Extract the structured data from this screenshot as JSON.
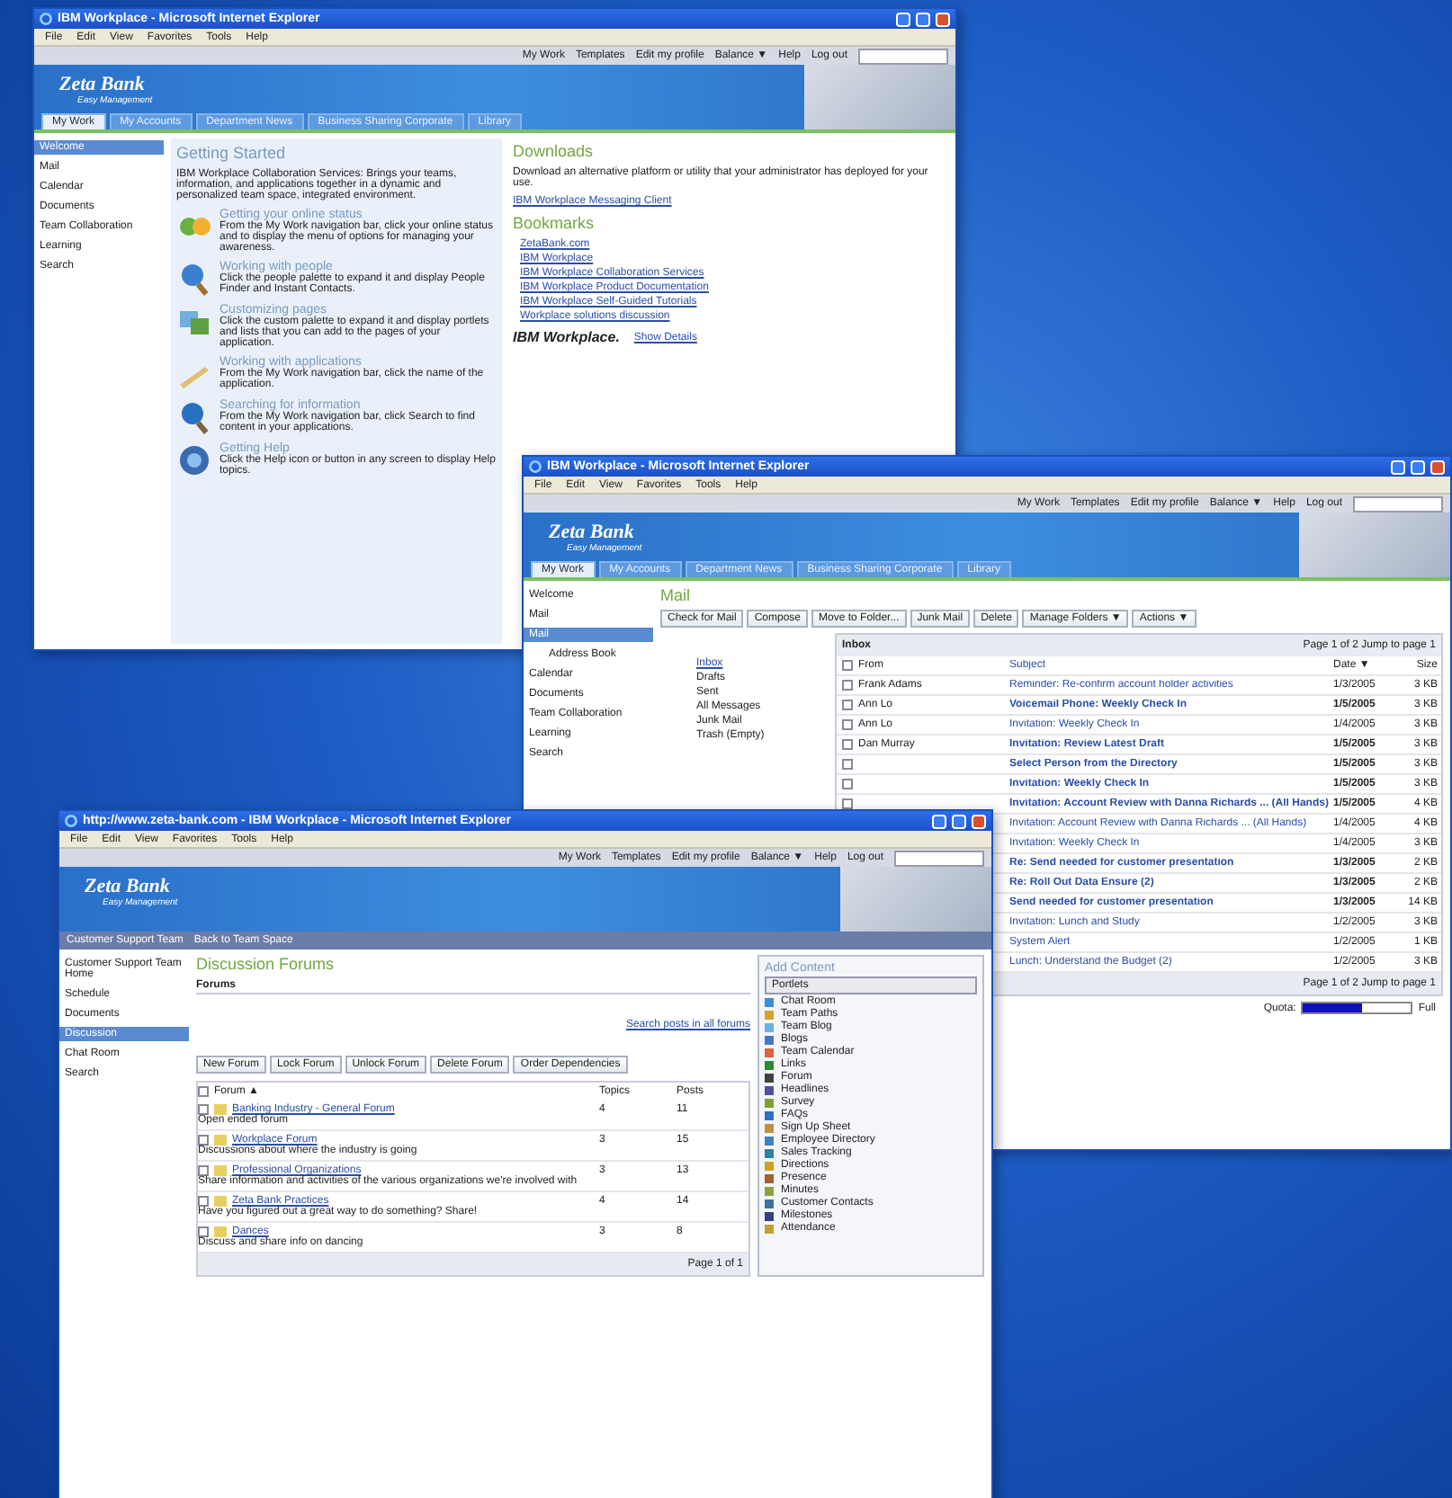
{
  "windows": [
    {
      "kind": "home",
      "title": "IBM Workplace - Microsoft Internet Explorer",
      "menu": [
        "File",
        "Edit",
        "View",
        "Favorites",
        "Tools",
        "Help"
      ],
      "top_links": [
        "My Work",
        "Templates",
        "Edit my profile",
        "Balance ▼",
        "Help",
        "Log out"
      ],
      "logo": "Zeta Bank",
      "logo_tagline": "Easy Management",
      "tabs": [
        {
          "label": "My Work",
          "selected": true
        },
        {
          "label": "My Accounts",
          "selected": false
        },
        {
          "label": "Department News",
          "selected": false
        },
        {
          "label": "Business Sharing Corporate",
          "selected": false
        },
        {
          "label": "Library",
          "selected": false
        }
      ],
      "sidebar": [
        {
          "label": "Welcome",
          "selected": true
        },
        {
          "label": "Mail",
          "selected": false
        },
        {
          "label": "Calendar",
          "selected": false
        },
        {
          "label": "Documents",
          "selected": false
        },
        {
          "label": "Team Collaboration",
          "selected": false
        },
        {
          "label": "Learning",
          "selected": false
        },
        {
          "label": "Search",
          "selected": false
        }
      ],
      "getting_started": {
        "title": "Getting Started",
        "intro": "IBM Workplace Collaboration Services: Brings your teams, information, and applications together in a dynamic and personalized team space, integrated environment.",
        "items": [
          {
            "title": "Getting your online status",
            "text": "From the My Work navigation bar, click your online status and to display the menu of options for managing your awareness."
          },
          {
            "title": "Working with people",
            "text": "Click the people palette to expand it and display People Finder and Instant Contacts."
          },
          {
            "title": "Customizing pages",
            "text": "Click the custom palette to expand it and display portlets and lists that you can add to the pages of your application."
          },
          {
            "title": "Working with applications",
            "text": "From the My Work navigation bar, click the name of the application."
          },
          {
            "title": "Searching for information",
            "text": "From the My Work navigation bar, click Search to find content in your applications."
          },
          {
            "title": "Getting Help",
            "text": "Click the Help icon or button in any screen to display Help topics."
          }
        ]
      },
      "downloads": {
        "title": "Downloads",
        "text": "Download an alternative platform or utility that your administrator has deployed for your use.",
        "link": "IBM Workplace Messaging Client"
      },
      "bookmarks": {
        "title": "Bookmarks",
        "items": [
          "ZetaBank.com",
          "IBM Workplace",
          "IBM Workplace Collaboration Services",
          "IBM Workplace Product Documentation",
          "IBM Workplace Self-Guided Tutorials",
          "Workplace solutions discussion"
        ]
      },
      "footer_brand": "IBM Workplace.",
      "footer_link": "Show Details"
    },
    {
      "kind": "mail",
      "title": "IBM Workplace - Microsoft Internet Explorer",
      "menu": [
        "File",
        "Edit",
        "View",
        "Favorites",
        "Tools",
        "Help"
      ],
      "top_links": [
        "My Work",
        "Templates",
        "Edit my profile",
        "Balance ▼",
        "Help",
        "Log out"
      ],
      "logo": "Zeta Bank",
      "logo_tagline": "Easy Management",
      "tabs": [
        {
          "label": "My Work",
          "selected": true
        },
        {
          "label": "My Accounts",
          "selected": false
        },
        {
          "label": "Department News",
          "selected": false
        },
        {
          "label": "Business Sharing Corporate",
          "selected": false
        },
        {
          "label": "Library",
          "selected": false
        }
      ],
      "sidebar": [
        {
          "label": "Welcome",
          "selected": false
        },
        {
          "label": "Mail",
          "selected": false
        },
        {
          "label": "Mail",
          "selected": true
        },
        {
          "label": "Address Book",
          "selected": false
        },
        {
          "label": "Calendar",
          "selected": false
        },
        {
          "label": "Documents",
          "selected": false
        },
        {
          "label": "Team Collaboration",
          "selected": false
        },
        {
          "label": "Learning",
          "selected": false
        },
        {
          "label": "Search",
          "selected": false
        }
      ],
      "page_title": "Mail",
      "toolbar": [
        "Check for Mail",
        "Compose",
        "Move to Folder...",
        "Junk Mail",
        "Delete",
        "Manage Folders ▼",
        "Actions ▼"
      ],
      "folders": [
        {
          "label": "Inbox",
          "selected": true
        },
        {
          "label": "Drafts",
          "selected": false
        },
        {
          "label": "Sent",
          "selected": false
        },
        {
          "label": "All Messages",
          "selected": false
        },
        {
          "label": "Junk Mail",
          "selected": false
        },
        {
          "label": "Trash (Empty)",
          "selected": false
        }
      ],
      "inbox": {
        "title": "Inbox",
        "select_all_checked": false,
        "pager": "Page 1 of 2",
        "jump": "Jump to page 1",
        "columns": [
          "From",
          "Subject",
          "Date ▼",
          "Size"
        ],
        "rows": [
          {
            "checked": false,
            "unread": false,
            "from": "Frank Adams",
            "subject": "Reminder: Re-confirm account holder activities",
            "date": "1/3/2005",
            "size": "3 KB"
          },
          {
            "checked": false,
            "unread": true,
            "from": "Ann Lo",
            "subject": "Voicemail Phone: Weekly Check In",
            "date": "1/5/2005",
            "size": "3 KB"
          },
          {
            "checked": false,
            "unread": false,
            "from": "Ann Lo",
            "subject": "Invitation: Weekly Check In",
            "date": "1/4/2005",
            "size": "3 KB"
          },
          {
            "checked": false,
            "unread": true,
            "from": "Dan Murray",
            "subject": "Invitation: Review Latest Draft",
            "date": "1/5/2005",
            "size": "3 KB"
          },
          {
            "checked": false,
            "unread": true,
            "subject": "Select Person from the Directory",
            "date": "1/5/2005",
            "size": "3 KB"
          },
          {
            "checked": false,
            "unread": true,
            "subject": "Invitation: Weekly Check In",
            "date": "1/5/2005",
            "size": "3 KB"
          },
          {
            "checked": false,
            "unread": true,
            "subject": "Invitation: Account Review with Danna Richards ... (All Hands)",
            "date": "1/5/2005",
            "size": "4 KB"
          },
          {
            "unread": false,
            "subject": "Invitation: Account Review with Danna Richards ... (All Hands)",
            "date": "1/4/2005",
            "size": "4 KB"
          },
          {
            "unread": false,
            "subject": "Invitation: Weekly Check In",
            "date": "1/4/2005",
            "size": "3 KB"
          },
          {
            "unread": true,
            "subject": "Re: Send needed for customer presentation",
            "date": "1/3/2005",
            "size": "2 KB"
          },
          {
            "unread": true,
            "subject": "Re: Roll Out Data Ensure (2)",
            "date": "1/3/2005",
            "size": "2 KB"
          },
          {
            "unread": true,
            "subject": "Send needed for customer presentation",
            "date": "1/3/2005",
            "size": "14 KB"
          },
          {
            "unread": false,
            "subject": "Invitation: Lunch and Study",
            "date": "1/2/2005",
            "size": "3 KB"
          },
          {
            "unread": false,
            "subject": "System Alert",
            "date": "1/2/2005",
            "size": "1 KB"
          },
          {
            "unread": false,
            "subject": "Lunch: Understand the Budget (2)",
            "date": "1/2/2005",
            "size": "3 KB"
          }
        ],
        "footer_pager": "Page 1 of 2",
        "footer_jump": "Jump to page 1"
      },
      "quota": {
        "label": "Quota:",
        "level": 0.55,
        "end_label": "Full"
      }
    },
    {
      "kind": "forums",
      "title": "http://www.zeta-bank.com - IBM Workplace - Microsoft Internet Explorer",
      "menu": [
        "File",
        "Edit",
        "View",
        "Favorites",
        "Tools",
        "Help"
      ],
      "top_links": [
        "My Work",
        "Templates",
        "Edit my profile",
        "Balance ▼",
        "Help",
        "Log out"
      ],
      "logo": "Zeta Bank",
      "logo_tagline": "Easy Management",
      "nav_links": [
        "Customer Support Team",
        "Back to Team Space"
      ],
      "sidebar": [
        {
          "label": "Customer Support Team Home",
          "selected": false
        },
        {
          "label": "Schedule",
          "selected": false
        },
        {
          "label": "Documents",
          "selected": false
        },
        {
          "label": "Discussion",
          "selected": true
        },
        {
          "label": "Chat Room",
          "selected": false
        },
        {
          "label": "Search",
          "selected": false
        }
      ],
      "page_title": "Discussion Forums",
      "section": "Forums",
      "search_link": "Search posts in all forums",
      "toolbar": [
        "New Forum",
        "Lock Forum",
        "Unlock Forum",
        "Delete Forum",
        "Order Dependencies"
      ],
      "columns": [
        "Forum ▲",
        "Topics",
        "Posts"
      ],
      "select_all_checked": false,
      "forums": [
        {
          "checked": false,
          "name": "Banking Industry - General Forum",
          "description": "Open ended forum",
          "topics": "4",
          "posts": "11"
        },
        {
          "checked": false,
          "name": "Workplace Forum",
          "description": "Discussions about where the industry is going",
          "topics": "3",
          "posts": "15"
        },
        {
          "checked": false,
          "name": "Professional Organizations",
          "description": "Share information and activities of the various organizations we're involved with",
          "topics": "3",
          "posts": "13"
        },
        {
          "checked": false,
          "name": "Zeta Bank Practices",
          "description": "Have you figured out a great way to do something? Share!",
          "topics": "4",
          "posts": "14"
        },
        {
          "checked": false,
          "name": "Dances",
          "description": "Discuss and share info on dancing",
          "topics": "3",
          "posts": "8"
        }
      ],
      "pager": "Page 1 of 1",
      "add_content": {
        "title": "Add Content",
        "dropdown": "Portlets",
        "items": [
          "Chat Room",
          "Team Paths",
          "Team Blog",
          "Blogs",
          "Team Calendar",
          "Links",
          "Forum",
          "Headlines",
          "Survey",
          "FAQs",
          "Sign Up Sheet",
          "Employee Directory",
          "Sales Tracking",
          "Directions",
          "Presence",
          "Minutes",
          "Customer Contacts",
          "Milestones",
          "Attendance"
        ]
      }
    }
  ]
}
